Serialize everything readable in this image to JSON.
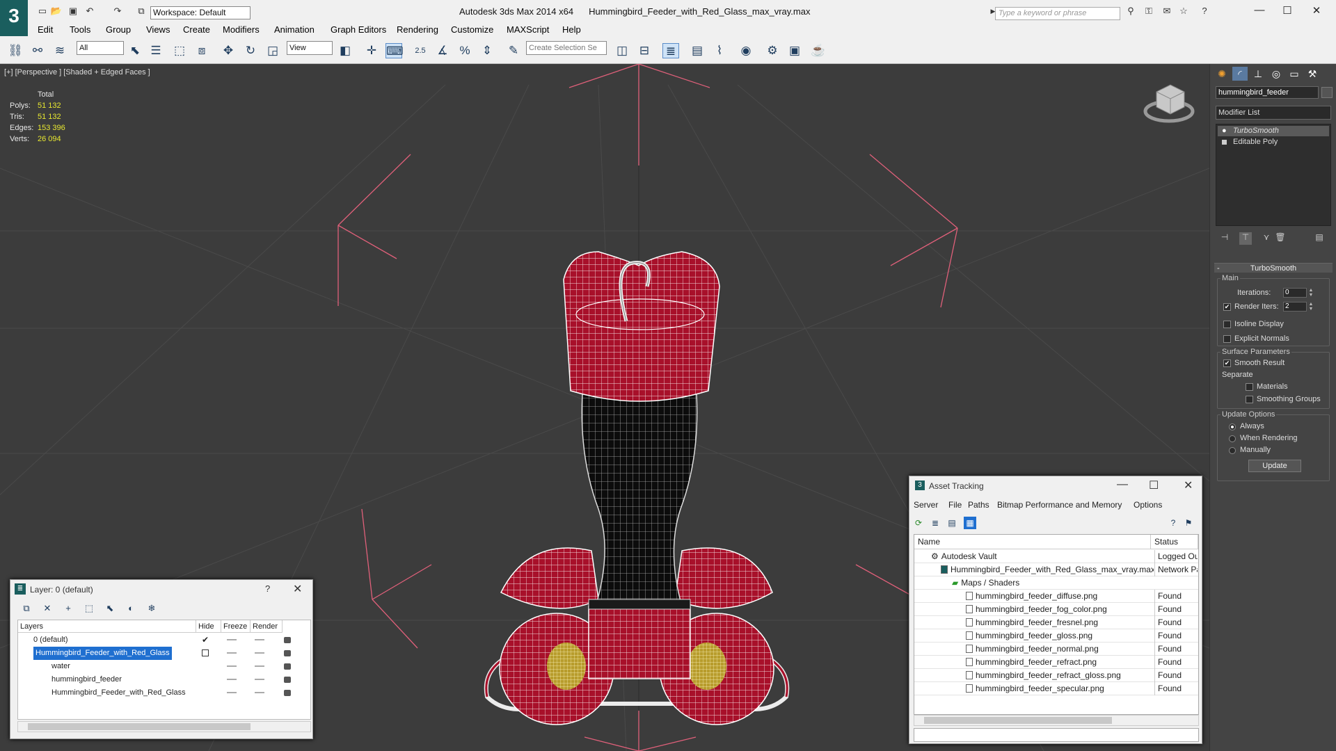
{
  "app": {
    "title": "Autodesk 3ds Max  2014 x64",
    "file": "Hummingbird_Feeder_with_Red_Glass_max_vray.max",
    "workspace": "Workspace: Default",
    "search_placeholder": "Type a keyword or phrase"
  },
  "menu": [
    "Edit",
    "Tools",
    "Group",
    "Views",
    "Create",
    "Modifiers",
    "Animation",
    "Graph Editors",
    "Rendering",
    "Customize",
    "MAXScript",
    "Help"
  ],
  "toolbar": {
    "filter": "All",
    "ref_coord": "View",
    "selection_set_placeholder": "Create Selection Se",
    "snap_label": "2.5"
  },
  "viewport": {
    "label": "[+] [Perspective ] [Shaded + Edged Faces ]",
    "stats": {
      "header": "Total",
      "rows": [
        {
          "label": "Polys:",
          "value": "51 132"
        },
        {
          "label": "Tris:",
          "value": "51 132"
        },
        {
          "label": "Edges:",
          "value": "153 396"
        },
        {
          "label": "Verts:",
          "value": "26 094"
        }
      ]
    }
  },
  "command_panel": {
    "object_name": "hummingbird_feeder",
    "modifier_list": "Modifier List",
    "stack": [
      "TurboSmooth",
      "Editable Poly"
    ],
    "rollout_title": "TurboSmooth",
    "main_group": "Main",
    "iterations_label": "Iterations:",
    "iterations_value": "0",
    "render_iters_label": "Render Iters:",
    "render_iters_value": "2",
    "isoline": "Isoline Display",
    "explicit_normals": "Explicit Normals",
    "surface_params": "Surface Parameters",
    "smooth_result": "Smooth Result",
    "separate": "Separate",
    "materials": "Materials",
    "smoothing_groups": "Smoothing Groups",
    "update_options": "Update Options",
    "always": "Always",
    "when_rendering": "When Rendering",
    "manually": "Manually",
    "update_button": "Update"
  },
  "layer_dialog": {
    "title": "Layer: 0 (default)",
    "help": "?",
    "columns": [
      "Layers",
      "Hide",
      "Freeze",
      "Render"
    ],
    "rows": [
      {
        "name": "0 (default)",
        "indent": 1,
        "selected": false,
        "check": true
      },
      {
        "name": "Hummingbird_Feeder_with_Red_Glass",
        "indent": 1,
        "selected": true,
        "check": false
      },
      {
        "name": "water",
        "indent": 2,
        "selected": false,
        "check": false
      },
      {
        "name": "hummingbird_feeder",
        "indent": 2,
        "selected": false,
        "check": false
      },
      {
        "name": "Hummingbird_Feeder_with_Red_Glass",
        "indent": 2,
        "selected": false,
        "check": false
      }
    ]
  },
  "asset_dialog": {
    "title": "Asset Tracking",
    "menu": [
      "Server",
      "File",
      "Paths",
      "Bitmap Performance and Memory",
      "Options"
    ],
    "columns": [
      "Name",
      "Status"
    ],
    "rows": [
      {
        "name": "Autodesk Vault",
        "status": "Logged Out",
        "indent": 1
      },
      {
        "name": "Hummingbird_Feeder_with_Red_Glass_max_vray.max",
        "status": "Network Pat",
        "indent": 2
      },
      {
        "name": "Maps / Shaders",
        "status": "",
        "indent": 3
      },
      {
        "name": "hummingbird_feeder_diffuse.png",
        "status": "Found",
        "indent": 4
      },
      {
        "name": "hummingbird_feeder_fog_color.png",
        "status": "Found",
        "indent": 4
      },
      {
        "name": "hummingbird_feeder_fresnel.png",
        "status": "Found",
        "indent": 4
      },
      {
        "name": "hummingbird_feeder_gloss.png",
        "status": "Found",
        "indent": 4
      },
      {
        "name": "hummingbird_feeder_normal.png",
        "status": "Found",
        "indent": 4
      },
      {
        "name": "hummingbird_feeder_refract.png",
        "status": "Found",
        "indent": 4
      },
      {
        "name": "hummingbird_feeder_refract_gloss.png",
        "status": "Found",
        "indent": 4
      },
      {
        "name": "hummingbird_feeder_specular.png",
        "status": "Found",
        "indent": 4
      }
    ]
  },
  "colors": {
    "feeder_red": "#a8102a",
    "wire": "#ffffff",
    "grid": "#4a4a4a",
    "select_blue": "#1f6fd0"
  }
}
